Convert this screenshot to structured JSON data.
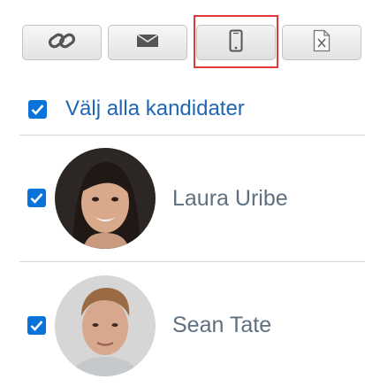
{
  "toolbar": {
    "buttons": [
      {
        "icon": "link-icon",
        "selected": false
      },
      {
        "icon": "envelope-icon",
        "selected": false
      },
      {
        "icon": "mobile-phone-icon",
        "selected": true
      },
      {
        "icon": "excel-file-icon",
        "selected": false
      }
    ],
    "highlight_color": "#e0383c"
  },
  "select_all": {
    "label": "Välj alla kandidater",
    "checked": true
  },
  "candidates": [
    {
      "name": "Laura Uribe",
      "checked": true,
      "avatar": "portrait-photo"
    },
    {
      "name": "Sean Tate",
      "checked": true,
      "avatar": "portrait-photo"
    }
  ],
  "colors": {
    "accent": "#0a73d9",
    "link": "#1f67b4",
    "name_text": "#5f7080"
  }
}
